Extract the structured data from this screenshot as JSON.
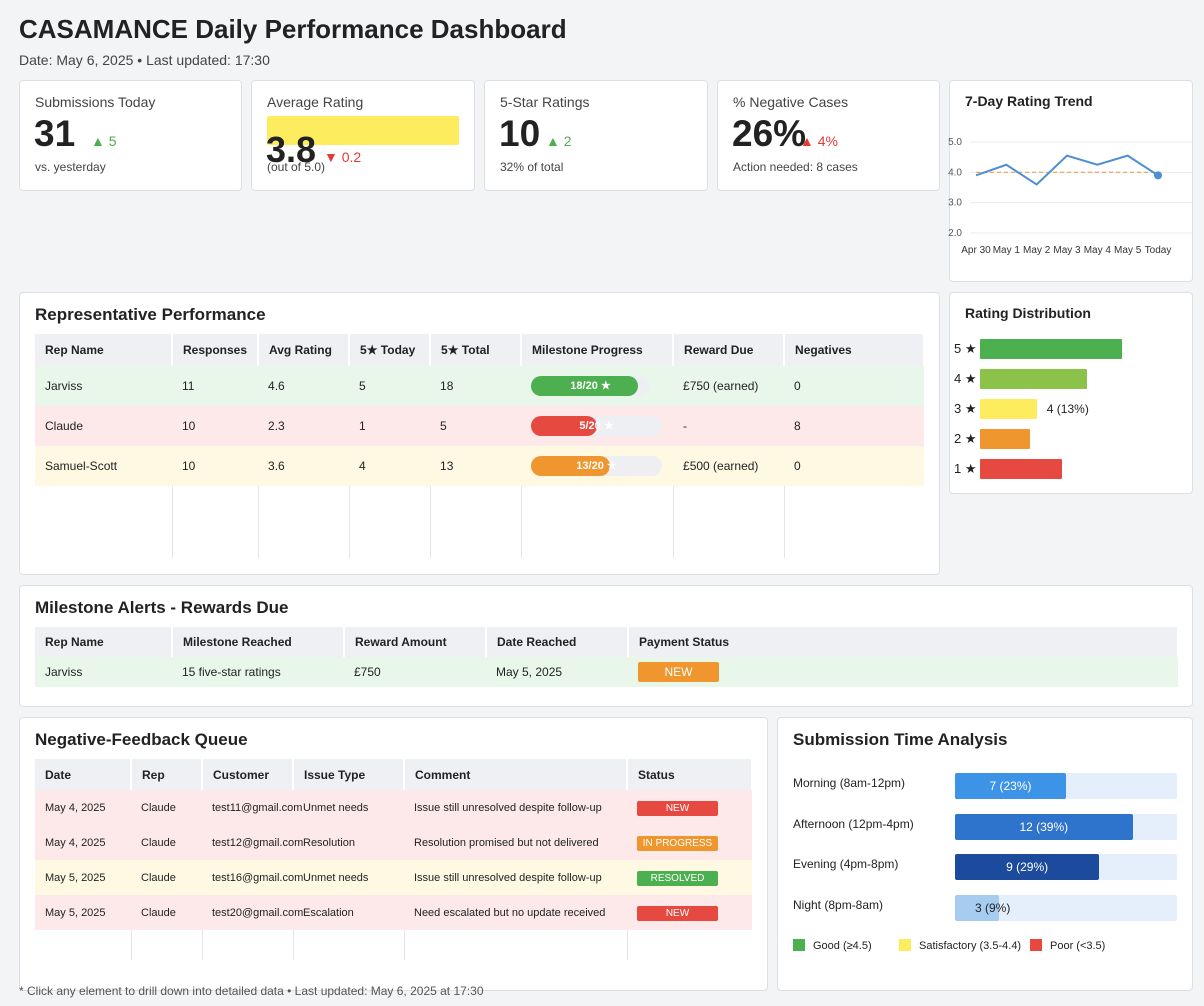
{
  "header": {
    "title": "CASAMANCE Daily Performance Dashboard",
    "subtitle": "Date: May 6, 2025 • Last updated: 17:30"
  },
  "kpis": {
    "submissions": {
      "label": "Submissions Today",
      "value": "31",
      "delta": "▲ 5",
      "sub": "vs. yesterday"
    },
    "avg_rating": {
      "label": "Average Rating",
      "value": "3.8",
      "delta": "▼ 0.2",
      "sub": "(out of 5.0)"
    },
    "five_star": {
      "label": "5-Star Ratings",
      "value": "10",
      "delta": "▲ 2",
      "sub": "32% of total"
    },
    "negative": {
      "label": "% Negative Cases",
      "value": "26%",
      "delta": "▲ 4%",
      "sub": "Action needed: 8 cases"
    }
  },
  "trend": {
    "title": "7-Day Rating Trend",
    "chart_data": {
      "type": "line",
      "x": [
        "Apr 30",
        "May 1",
        "May 2",
        "May 3",
        "May 4",
        "May 5",
        "Today"
      ],
      "values": [
        3.9,
        4.25,
        3.6,
        4.55,
        4.25,
        4.55,
        3.9
      ],
      "y_ticks": [
        "5.0",
        "4.0",
        "3.0",
        "2.0"
      ],
      "ylim": [
        2.0,
        5.0
      ],
      "reference_line": 4.0,
      "colors": {
        "line": "#4e8fd1",
        "reference": "#f0a04b"
      }
    }
  },
  "rep_performance": {
    "title": "Representative Performance",
    "columns": [
      "Rep Name",
      "Responses",
      "Avg Rating",
      "5★ Today",
      "5★ Total",
      "Milestone Progress",
      "Reward Due",
      "Negatives"
    ],
    "rows": [
      {
        "name": "Jarviss",
        "responses": "11",
        "avg": "4.6",
        "today": "5",
        "total": "18",
        "milestone_text": "18/20 ★",
        "milestone_fraction": 0.9,
        "milestone_color": "#4caf50",
        "reward": "£750 (earned)",
        "negatives": "0",
        "tone": "green"
      },
      {
        "name": "Claude",
        "responses": "10",
        "avg": "2.3",
        "today": "1",
        "total": "5",
        "milestone_text": "5/20 ★",
        "milestone_fraction": 0.5,
        "milestone_color": "#e5493f",
        "reward": "-",
        "negatives": "8",
        "tone": "red"
      },
      {
        "name": "Samuel-Scott",
        "responses": "10",
        "avg": "3.6",
        "today": "4",
        "total": "13",
        "milestone_text": "13/20 ★",
        "milestone_fraction": 0.6,
        "milestone_color": "#f0962e",
        "reward": "£500 (earned)",
        "negatives": "0",
        "tone": "yellow"
      }
    ]
  },
  "distribution": {
    "title": "Rating Distribution",
    "chart_data": {
      "type": "bar",
      "categories": [
        "5 ★",
        "4 ★",
        "3 ★",
        "2 ★",
        "1 ★"
      ],
      "values": [
        10,
        7.5,
        4,
        3.5,
        5.8
      ],
      "labels": [
        "",
        "",
        "4 (13%)",
        "",
        ""
      ],
      "colors": [
        "#4caf50",
        "#8bc34a",
        "#fded5e",
        "#f0962e",
        "#e5493f"
      ],
      "xmax": 10
    }
  },
  "milestones": {
    "title": "Milestone Alerts - Rewards Due",
    "columns": [
      "Rep Name",
      "Milestone Reached",
      "Reward Amount",
      "Date Reached",
      "Payment Status"
    ],
    "rows": [
      {
        "rep": "Jarviss",
        "milestone": "15 five-star ratings",
        "amount": "£750",
        "date": "May 5, 2025",
        "status": "NEW"
      }
    ]
  },
  "negative_queue": {
    "title": "Negative-Feedback Queue",
    "columns": [
      "Date",
      "Rep",
      "Customer",
      "Issue Type",
      "Comment",
      "Status"
    ],
    "rows": [
      {
        "date": "May 4, 2025",
        "rep": "Claude",
        "customer": "test11@gmail.com",
        "issue": "Unmet needs",
        "comment": "Issue still unresolved despite follow-up",
        "status": "NEW",
        "status_color": "#e5493f",
        "tone": "red"
      },
      {
        "date": "May 4, 2025",
        "rep": "Claude",
        "customer": "test12@gmail.com",
        "issue": "Resolution",
        "comment": "Resolution promised but not delivered",
        "status": "IN PROGRESS",
        "status_color": "#f0962e",
        "tone": "red"
      },
      {
        "date": "May 5, 2025",
        "rep": "Claude",
        "customer": "test16@gmail.com",
        "issue": "Unmet needs",
        "comment": "Issue still unresolved despite follow-up",
        "status": "RESOLVED",
        "status_color": "#4caf50",
        "tone": "yellow"
      },
      {
        "date": "May 5, 2025",
        "rep": "Claude",
        "customer": "test20@gmail.com",
        "issue": "Escalation",
        "comment": "Need escalated but no update received",
        "status": "NEW",
        "status_color": "#e5493f",
        "tone": "red"
      }
    ]
  },
  "time_analysis": {
    "title": "Submission Time Analysis",
    "chart_data": {
      "type": "bar",
      "categories": [
        "Morning (8am-12pm)",
        "Afternoon (12pm-4pm)",
        "Evening (4pm-8pm)",
        "Night (8pm-8am)"
      ],
      "values": [
        7,
        12,
        9,
        3
      ],
      "percents": [
        23,
        39,
        29,
        9
      ],
      "labels": [
        "7 (23%)",
        "12 (39%)",
        "9 (29%)",
        "3 (9%)"
      ],
      "colors": [
        "#3d94e6",
        "#2e73cc",
        "#1c4a9c",
        "#a6cdf0"
      ],
      "fill_fractions": [
        0.5,
        0.8,
        0.65,
        0.2
      ]
    },
    "legend": [
      {
        "label": "Good (≥4.5)",
        "color": "#4caf50"
      },
      {
        "label": "Satisfactory (3.5-4.4)",
        "color": "#fded5e"
      },
      {
        "label": "Poor (<3.5)",
        "color": "#e5493f"
      }
    ]
  },
  "footer": "* Click any element to drill down into detailed data • Last updated: May 6, 2025 at 17:30"
}
